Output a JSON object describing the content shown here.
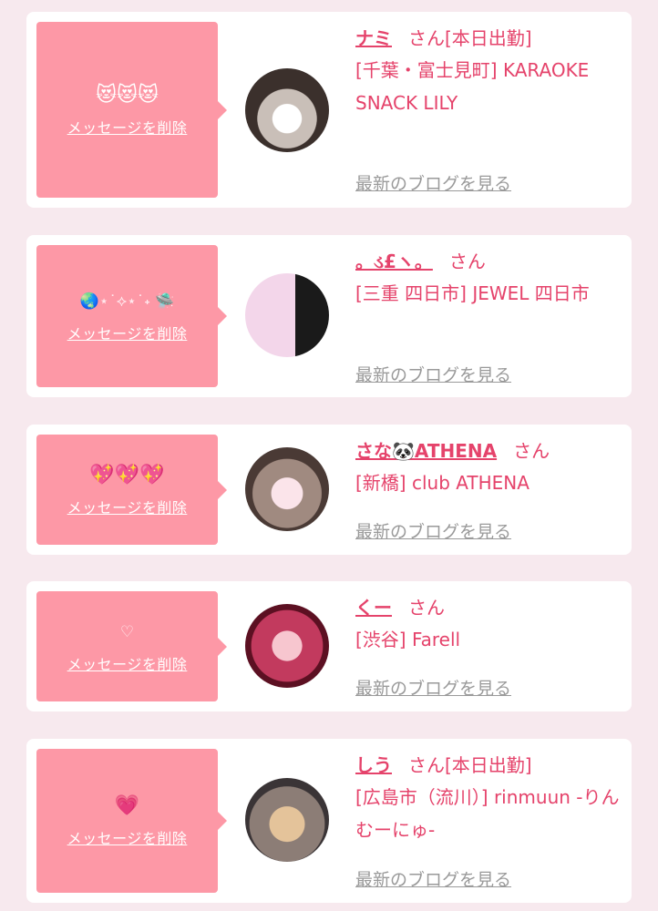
{
  "colors": {
    "accent": "#e5436b",
    "bubble": "#fd98a6",
    "background": "#f7e9ee"
  },
  "delete_label": "メッセージを削除",
  "blog_label": "最新のブログを見る",
  "san_label": "さん",
  "items": [
    {
      "stamp": "😻😻😻",
      "name": "ナミ",
      "status": "[本日出勤]",
      "shop": "[千葉・富士見町] KARAOKE SNACK LILY",
      "avatar_icon": "avatar-photo-icon"
    },
    {
      "stamp": "🌏⋆˙⟡⋆˙˖ 🛸",
      "name": "。ડ£ヽ。",
      "status": "",
      "shop": "[三重 四日市] JEWEL 四日市",
      "avatar_icon": "avatar-photo-icon"
    },
    {
      "stamp": "💖💖💖",
      "name": "さな🐼ATHENA",
      "status": "",
      "shop": "[新橋] club ATHENA",
      "avatar_icon": "avatar-photo-icon"
    },
    {
      "stamp": "♡",
      "name": "くー",
      "status": "",
      "shop": "[渋谷] Farell",
      "avatar_icon": "avatar-photo-icon"
    },
    {
      "stamp": "💗",
      "name": "しう",
      "status": "[本日出勤]",
      "shop": "[広島市（流川）] rinmuun -りんむーにゅ-",
      "avatar_icon": "avatar-photo-icon"
    }
  ]
}
